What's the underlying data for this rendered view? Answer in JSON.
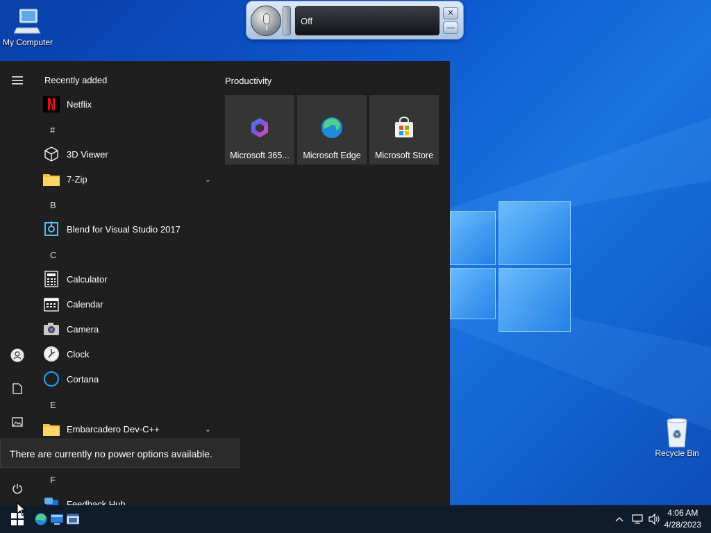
{
  "desktop": {
    "icons": [
      {
        "label": "My Computer"
      },
      {
        "label": "Recycle Bin"
      }
    ]
  },
  "speech_bar": {
    "status": "Off",
    "close_symbol": "✕",
    "minimize_symbol": "—"
  },
  "start_menu": {
    "recently_added_title": "Recently added",
    "apps": [
      {
        "type": "app",
        "label": "Netflix",
        "icon": "netflix-icon"
      },
      {
        "type": "letter",
        "label": "#"
      },
      {
        "type": "app",
        "label": "3D Viewer",
        "icon": "cube-icon"
      },
      {
        "type": "folder",
        "label": "7-Zip",
        "icon": "folder-icon"
      },
      {
        "type": "letter",
        "label": "B"
      },
      {
        "type": "app",
        "label": "Blend for Visual Studio 2017",
        "icon": "blend-icon"
      },
      {
        "type": "letter",
        "label": "C"
      },
      {
        "type": "app",
        "label": "Calculator",
        "icon": "calculator-icon"
      },
      {
        "type": "app",
        "label": "Calendar",
        "icon": "calendar-icon"
      },
      {
        "type": "app",
        "label": "Camera",
        "icon": "camera-icon"
      },
      {
        "type": "app",
        "label": "Clock",
        "icon": "clock-icon"
      },
      {
        "type": "app",
        "label": "Cortana",
        "icon": "cortana-icon"
      },
      {
        "type": "letter",
        "label": "E"
      },
      {
        "type": "folder",
        "label": "Embarcadero Dev-C++",
        "icon": "folder-icon"
      },
      {
        "type": "letter",
        "label": "F"
      },
      {
        "type": "app",
        "label": "Feedback Hub",
        "icon": "feedback-icon"
      }
    ],
    "tiles_group_title": "Productivity",
    "tiles": [
      {
        "label": "Microsoft 365...",
        "icon": "microsoft-365-icon"
      },
      {
        "label": "Microsoft Edge",
        "icon": "edge-icon"
      },
      {
        "label": "Microsoft Store",
        "icon": "store-icon"
      }
    ],
    "power_tooltip": "There are currently no power options available."
  },
  "taskbar": {
    "time": "4:06 AM",
    "date": "4/28/2023"
  },
  "colors": {
    "menu_bg": "#1f1f1f",
    "tile_bg": "#353535",
    "taskbar_bg": "#101c2c",
    "accent": "#0c56cf"
  }
}
